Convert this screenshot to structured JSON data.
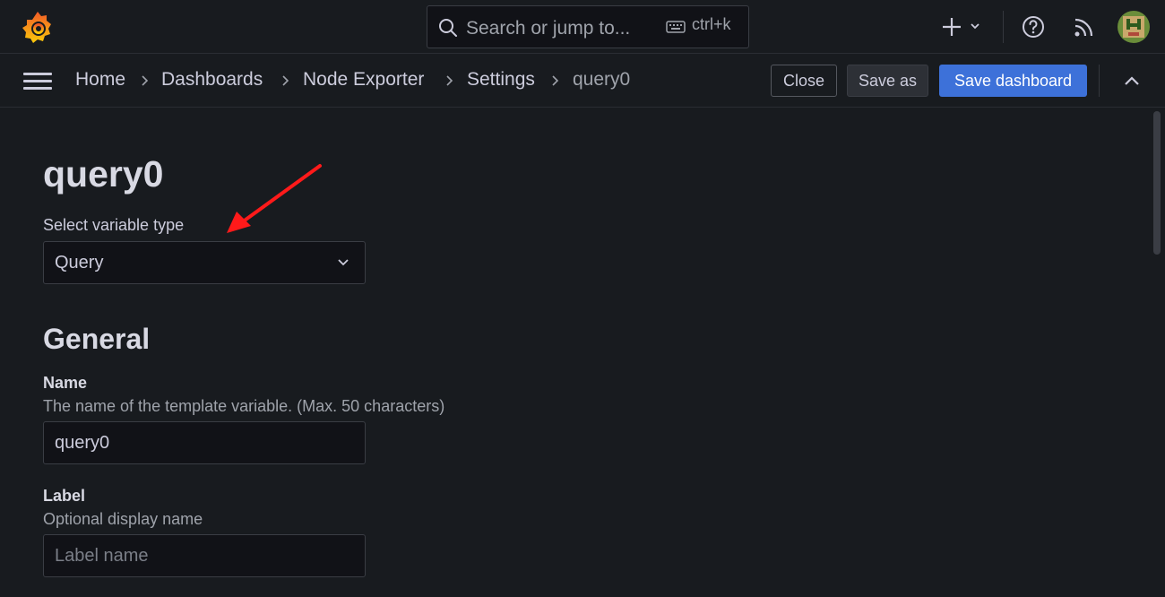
{
  "topbar": {
    "search_placeholder": "Search or jump to...",
    "shortcut": "ctrl+k"
  },
  "breadcrumb": [
    "Home",
    "Dashboards",
    "Node Exporter",
    "Settings",
    "query0"
  ],
  "toolbar": {
    "close_label": "Close",
    "save_as_label": "Save as",
    "save_dashboard_label": "Save dashboard"
  },
  "page": {
    "title": "query0",
    "variable_type_label": "Select variable type",
    "variable_type_value": "Query",
    "general_heading": "General",
    "name_label": "Name",
    "name_description": "The name of the template variable. (Max. 50 characters)",
    "name_value": "query0",
    "label_label": "Label",
    "label_description": "Optional display name",
    "label_placeholder": "Label name"
  },
  "icons": {
    "logo": "grafana-logo-icon",
    "search": "search-icon",
    "keyboard": "keyboard-icon",
    "plus": "plus-icon",
    "help": "help-icon",
    "news": "rss-icon",
    "menu": "menu-icon",
    "collapse": "chevron-up-icon"
  },
  "colors": {
    "background": "#181b1f",
    "primary_button": "#3d71d9",
    "logo_orange": "#f05a28",
    "annotation_arrow": "#ff1a1a"
  }
}
